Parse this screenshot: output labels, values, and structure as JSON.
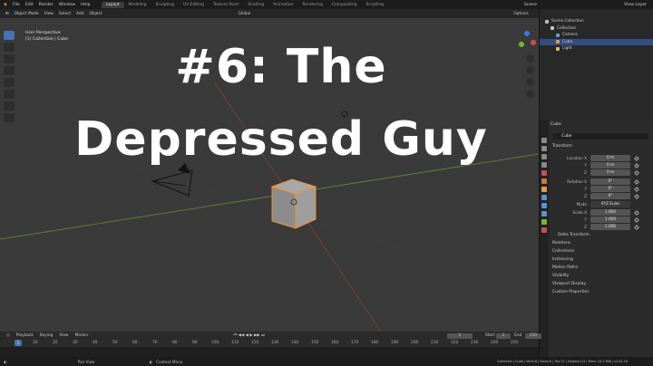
{
  "topbar": {
    "menu": [
      "File",
      "Edit",
      "Render",
      "Window",
      "Help"
    ],
    "tabs": [
      "Layout",
      "Modeling",
      "Sculpting",
      "UV Editing",
      "Texture Paint",
      "Shading",
      "Animation",
      "Rendering",
      "Compositing",
      "Scripting"
    ],
    "active_tab": "Layout",
    "scene": "Scene",
    "view_layer": "View Layer"
  },
  "viewport": {
    "mode": "Object Mode",
    "menu": [
      "View",
      "Select",
      "Add",
      "Object"
    ],
    "orientation": "Global",
    "options": "Options",
    "overlay_line1": "User Perspective",
    "overlay_line2": "(1) Collection | Cube"
  },
  "title": {
    "line1": "#6: The",
    "line2": "Depressed Guy"
  },
  "outliner": {
    "header": "Scene Collection",
    "items": [
      {
        "label": "Collection",
        "color": "#c9c9c9"
      },
      {
        "label": "Camera",
        "color": "#6b9bd8"
      },
      {
        "label": "Cube",
        "color": "#e79b4a"
      },
      {
        "label": "Light",
        "color": "#d4c06b"
      }
    ]
  },
  "properties": {
    "object_header": "Cube",
    "object_name": "Cube",
    "transform_label": "Transform",
    "location_label": "Location X",
    "location": [
      "0 m",
      "0 m",
      "0 m"
    ],
    "rotation_label": "Rotation X",
    "rotation": [
      "0°",
      "0°",
      "0°"
    ],
    "mode_label": "Mode",
    "mode_value": "XYZ Euler",
    "scale_label": "Scale X",
    "scale": [
      "1.000",
      "1.000",
      "1.000"
    ],
    "y_label": "Y",
    "z_label": "Z",
    "delta": "Delta Transform",
    "sections": [
      "Relations",
      "Collections",
      "Instancing",
      "Motion Paths",
      "Visibility",
      "Viewport Display",
      "Custom Properties"
    ]
  },
  "timeline": {
    "menu": [
      "Playback",
      "Keying",
      "View",
      "Marker"
    ],
    "current_frame": "1",
    "start_label": "Start",
    "start": "1",
    "end_label": "End",
    "end": "250",
    "ticks": [
      "10",
      "20",
      "30",
      "40",
      "50",
      "60",
      "70",
      "80",
      "90",
      "100",
      "110",
      "120",
      "130",
      "140",
      "150",
      "160",
      "170",
      "180",
      "190",
      "200",
      "210",
      "220",
      "230",
      "240",
      "250"
    ],
    "playhead": "1"
  },
  "statusbar": {
    "left": "Pan View",
    "middle": "Context Menu",
    "right": "Collection | Cube | Verts:8 | Faces:6 | Tris:12 | Objects:1/3 | Mem: 24.2 MiB | v2.81.16"
  }
}
